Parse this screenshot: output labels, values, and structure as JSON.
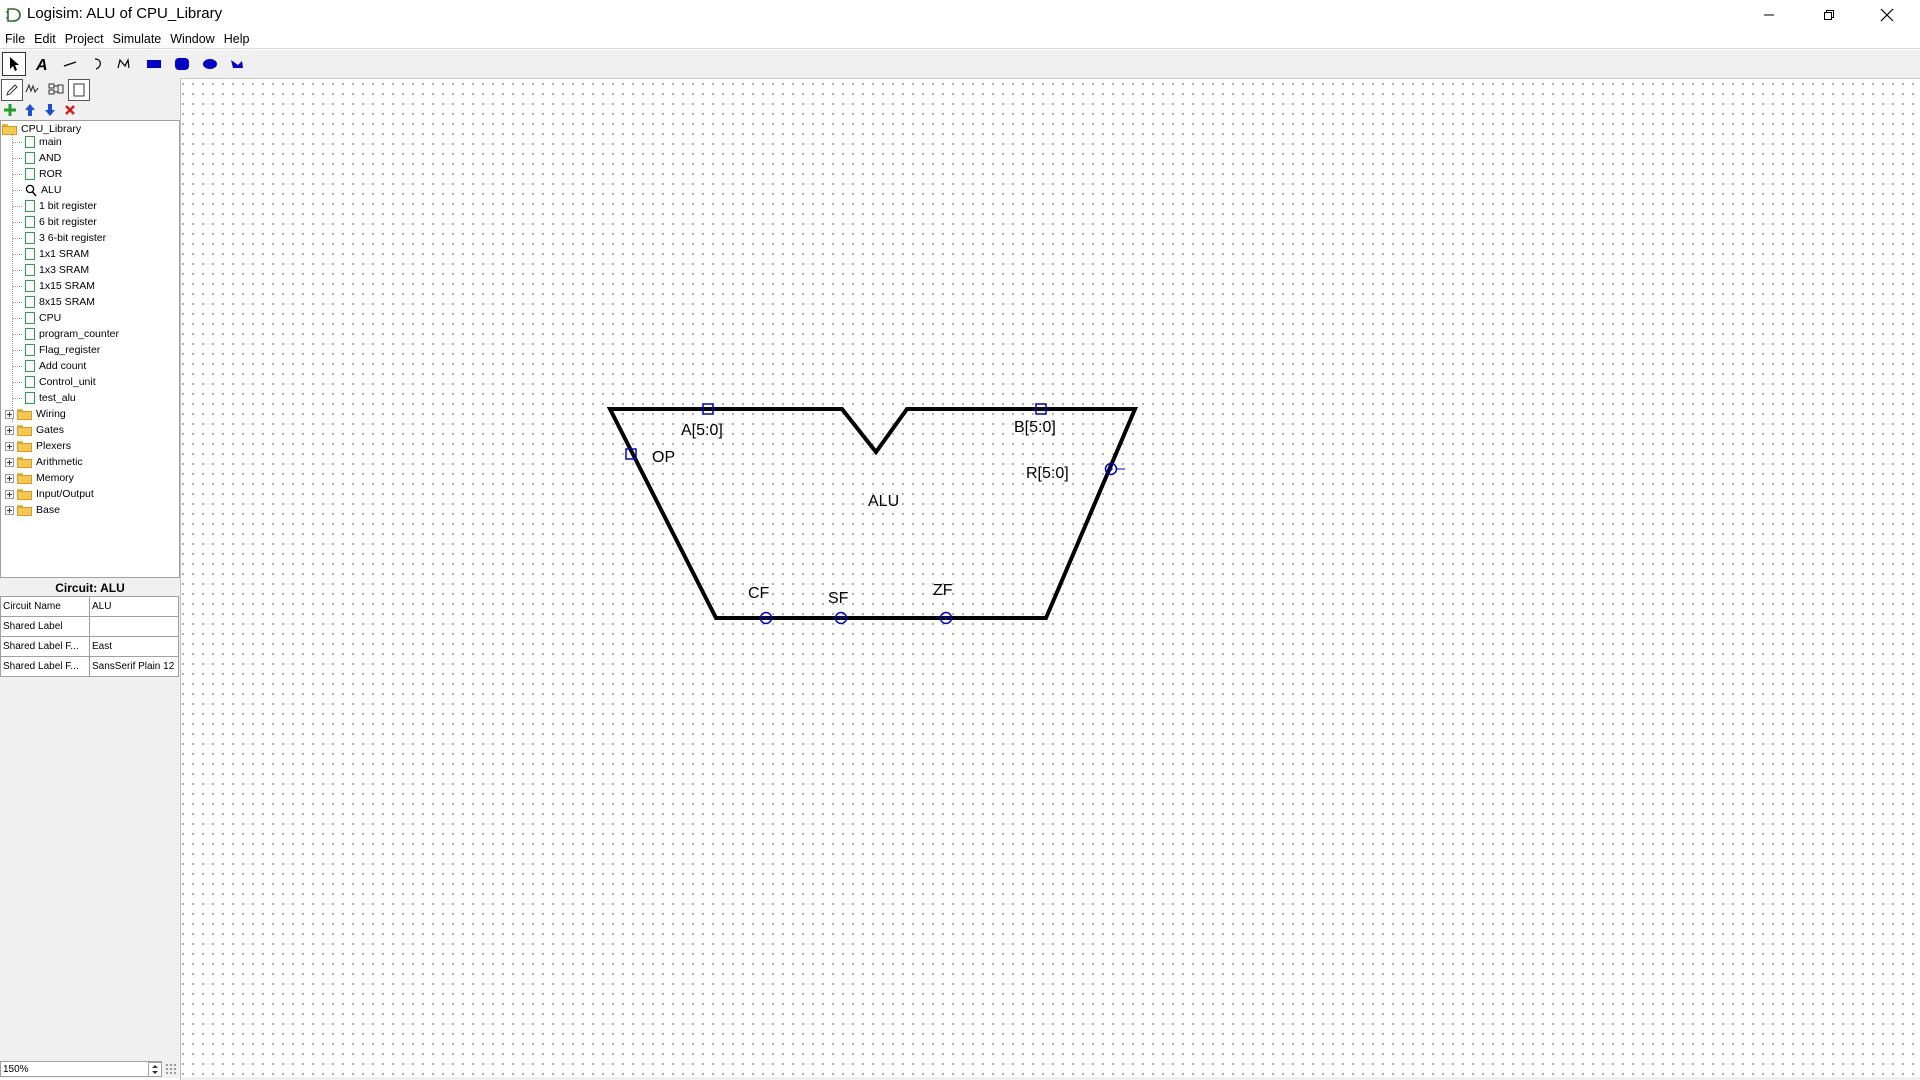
{
  "window": {
    "title": "Logisim: ALU of CPU_Library"
  },
  "menu": [
    "File",
    "Edit",
    "Project",
    "Simulate",
    "Window",
    "Help"
  ],
  "toolbar": {
    "tools": [
      "select-tool",
      "text-tool",
      "line-tool",
      "curve-tool",
      "polyline-tool",
      "rectangle-tool",
      "rounded-rectangle-tool",
      "oval-tool",
      "polygon-tool"
    ],
    "accent_color": "#0000c8"
  },
  "explorer": {
    "root": "CPU_Library",
    "circuits": [
      "main",
      "AND",
      "ROR",
      "ALU",
      "1 bit register",
      "6 bit register",
      "3 6-bit register",
      "1x1 SRAM",
      "1x3 SRAM",
      "1x15 SRAM",
      "8x15 SRAM",
      "CPU",
      "program_counter",
      "Flag_register",
      "Add count",
      "Control_unit",
      "test_alu"
    ],
    "current_circuit": "ALU",
    "libraries": [
      "Wiring",
      "Gates",
      "Plexers",
      "Arithmetic",
      "Memory",
      "Input/Output",
      "Base"
    ]
  },
  "attributes": {
    "title": "Circuit: ALU",
    "rows": [
      {
        "key": "Circuit Name",
        "value": "ALU"
      },
      {
        "key": "Shared Label",
        "value": ""
      },
      {
        "key": "Shared Label F...",
        "value": "East"
      },
      {
        "key": "Shared Label F...",
        "value": "SansSerif Plain 12"
      }
    ]
  },
  "zoom": "150%",
  "appearance": {
    "label": "ALU",
    "pins": {
      "a": "A[5:0]",
      "b": "B[5:0]",
      "op": "OP",
      "r": "R[5:0]",
      "cf": "CF",
      "sf": "SF",
      "zf": "ZF"
    },
    "input_pin_color": "#0000c8",
    "output_pin_color": "#0000c8"
  }
}
